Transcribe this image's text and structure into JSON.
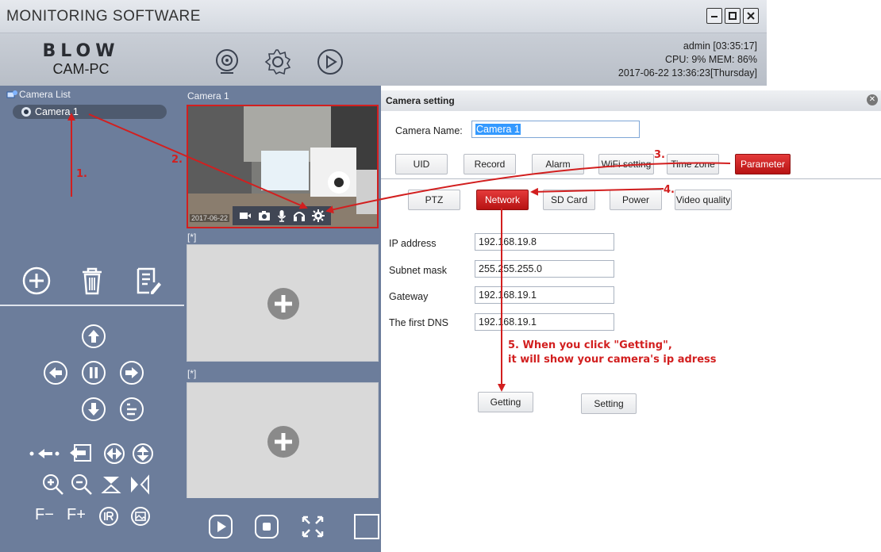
{
  "window": {
    "title": "MONITORING SOFTWARE",
    "controls": [
      "minimize-icon",
      "maximize-icon",
      "close-icon"
    ]
  },
  "header": {
    "brand": "BLOW",
    "product": "CAM-PC",
    "icons": [
      "camera-icon",
      "settings-gear-icon",
      "play-icon"
    ],
    "user_line": "admin  [03:35:17]",
    "cpu_line": "CPU: 9%  MEM: 86%",
    "datetime_line": "2017-06-22 13:36:23[Thursday]"
  },
  "sidebar": {
    "camera_list_title": "Camera List",
    "cameras": [
      {
        "label": "Camera 1"
      }
    ],
    "tools": [
      "add-icon",
      "trash-icon",
      "edit-icon"
    ],
    "ptz_text": {
      "focus_minus": "F−",
      "focus_plus": "F+"
    }
  },
  "video": {
    "slot1_title": "Camera 1",
    "slot1_timestamp": "2017-06-22",
    "slot2_title": "[*]",
    "slot3_title": "[*]",
    "overlay_icons": [
      "video-record-icon",
      "snapshot-icon",
      "microphone-icon",
      "headphones-icon",
      "gear-icon"
    ]
  },
  "settings": {
    "title": "Camera setting",
    "camera_name_label": "Camera Name:",
    "camera_name_value": "Camera 1",
    "tabs": [
      {
        "label": "UID"
      },
      {
        "label": "Record"
      },
      {
        "label": "Alarm"
      },
      {
        "label": "WiFi setting"
      },
      {
        "label": "Time zone"
      },
      {
        "label": "Parameter",
        "active": true
      }
    ],
    "subtabs": [
      {
        "label": "PTZ"
      },
      {
        "label": "Network",
        "active": true
      },
      {
        "label": "SD Card"
      },
      {
        "label": "Power"
      },
      {
        "label": "Video quality"
      }
    ],
    "fields": [
      {
        "label": "IP address",
        "value": "192.168.19.8"
      },
      {
        "label": "Subnet mask",
        "value": "255.255.255.0"
      },
      {
        "label": "Gateway",
        "value": "192.168.19.1"
      },
      {
        "label": "The first DNS",
        "value": "192.168.19.1"
      }
    ],
    "getting_label": "Getting",
    "setting_label": "Setting"
  },
  "annotations": {
    "step1": "1.",
    "step2": "2.",
    "step3": "3.",
    "step4": "4.",
    "step5_line1": "5. When you click \"Getting\",",
    "step5_line2": "it will show your camera's ip adress"
  },
  "colors": {
    "panel": "#6c7d9b",
    "accent_red": "#d21f1f",
    "active_tab": "#c41b1b"
  }
}
